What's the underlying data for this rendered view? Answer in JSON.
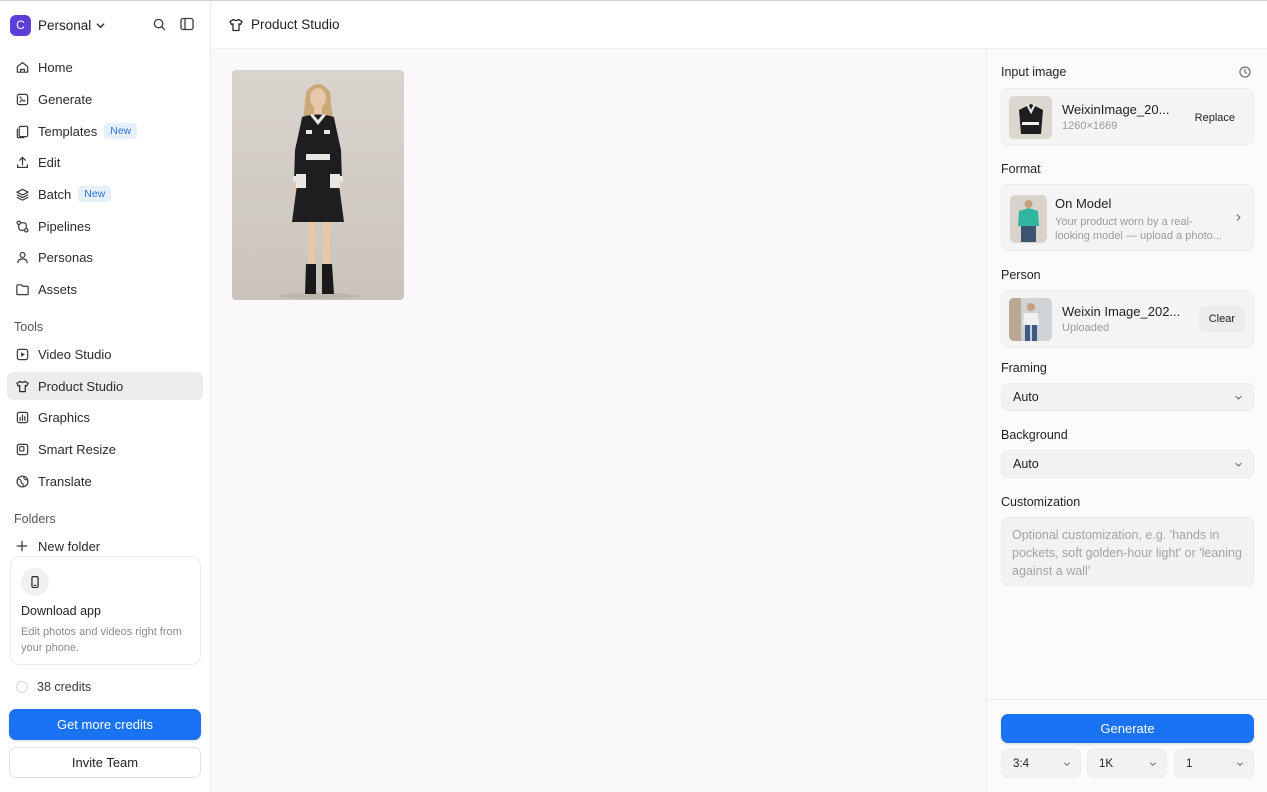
{
  "workspace": {
    "initial": "C",
    "name": "Personal"
  },
  "sidebar": {
    "nav": [
      {
        "label": "Home",
        "icon": "home-icon"
      },
      {
        "label": "Generate",
        "icon": "generate-icon"
      },
      {
        "label": "Templates",
        "icon": "templates-icon",
        "badge": "New"
      },
      {
        "label": "Edit",
        "icon": "upload-icon"
      },
      {
        "label": "Batch",
        "icon": "layers-icon",
        "badge": "New"
      },
      {
        "label": "Pipelines",
        "icon": "pipelines-icon"
      },
      {
        "label": "Personas",
        "icon": "person-icon"
      },
      {
        "label": "Assets",
        "icon": "folder-icon"
      }
    ],
    "tools_label": "Tools",
    "tools": [
      {
        "label": "Video Studio",
        "icon": "video-icon"
      },
      {
        "label": "Product Studio",
        "icon": "shirt-icon",
        "active": true
      },
      {
        "label": "Graphics",
        "icon": "chart-icon"
      },
      {
        "label": "Smart Resize",
        "icon": "resize-icon"
      },
      {
        "label": "Translate",
        "icon": "globe-icon"
      }
    ],
    "folders_label": "Folders",
    "new_folder": "New folder",
    "download": {
      "title": "Download app",
      "desc": "Edit photos and videos right from your phone."
    },
    "credits": "38 credits",
    "get_credits": "Get more credits",
    "invite": "Invite Team"
  },
  "header": {
    "title": "Product Studio"
  },
  "panel": {
    "input_label": "Input image",
    "input_file": {
      "name": "WeixinImage_20...",
      "dims": "1260×1669",
      "action": "Replace"
    },
    "format_label": "Format",
    "format": {
      "name": "On Model",
      "desc_line1": "Your product worn by a real-",
      "desc_line2": "looking model — upload a photo..."
    },
    "person_label": "Person",
    "person": {
      "name": "Weixin Image_202...",
      "status": "Uploaded",
      "action": "Clear"
    },
    "framing_label": "Framing",
    "framing_value": "Auto",
    "background_label": "Background",
    "background_value": "Auto",
    "custom_label": "Customization",
    "custom_placeholder": "Optional customization, e.g. 'hands in pockets, soft golden-hour light' or 'leaning against a wall'",
    "generate": "Generate",
    "aspect": "3:4",
    "resolution": "1K",
    "count": "1"
  },
  "colors": {
    "accent": "#1a73f5",
    "workspace_avatar": "#5b3fd6",
    "badge_text": "#2f6fd6"
  }
}
